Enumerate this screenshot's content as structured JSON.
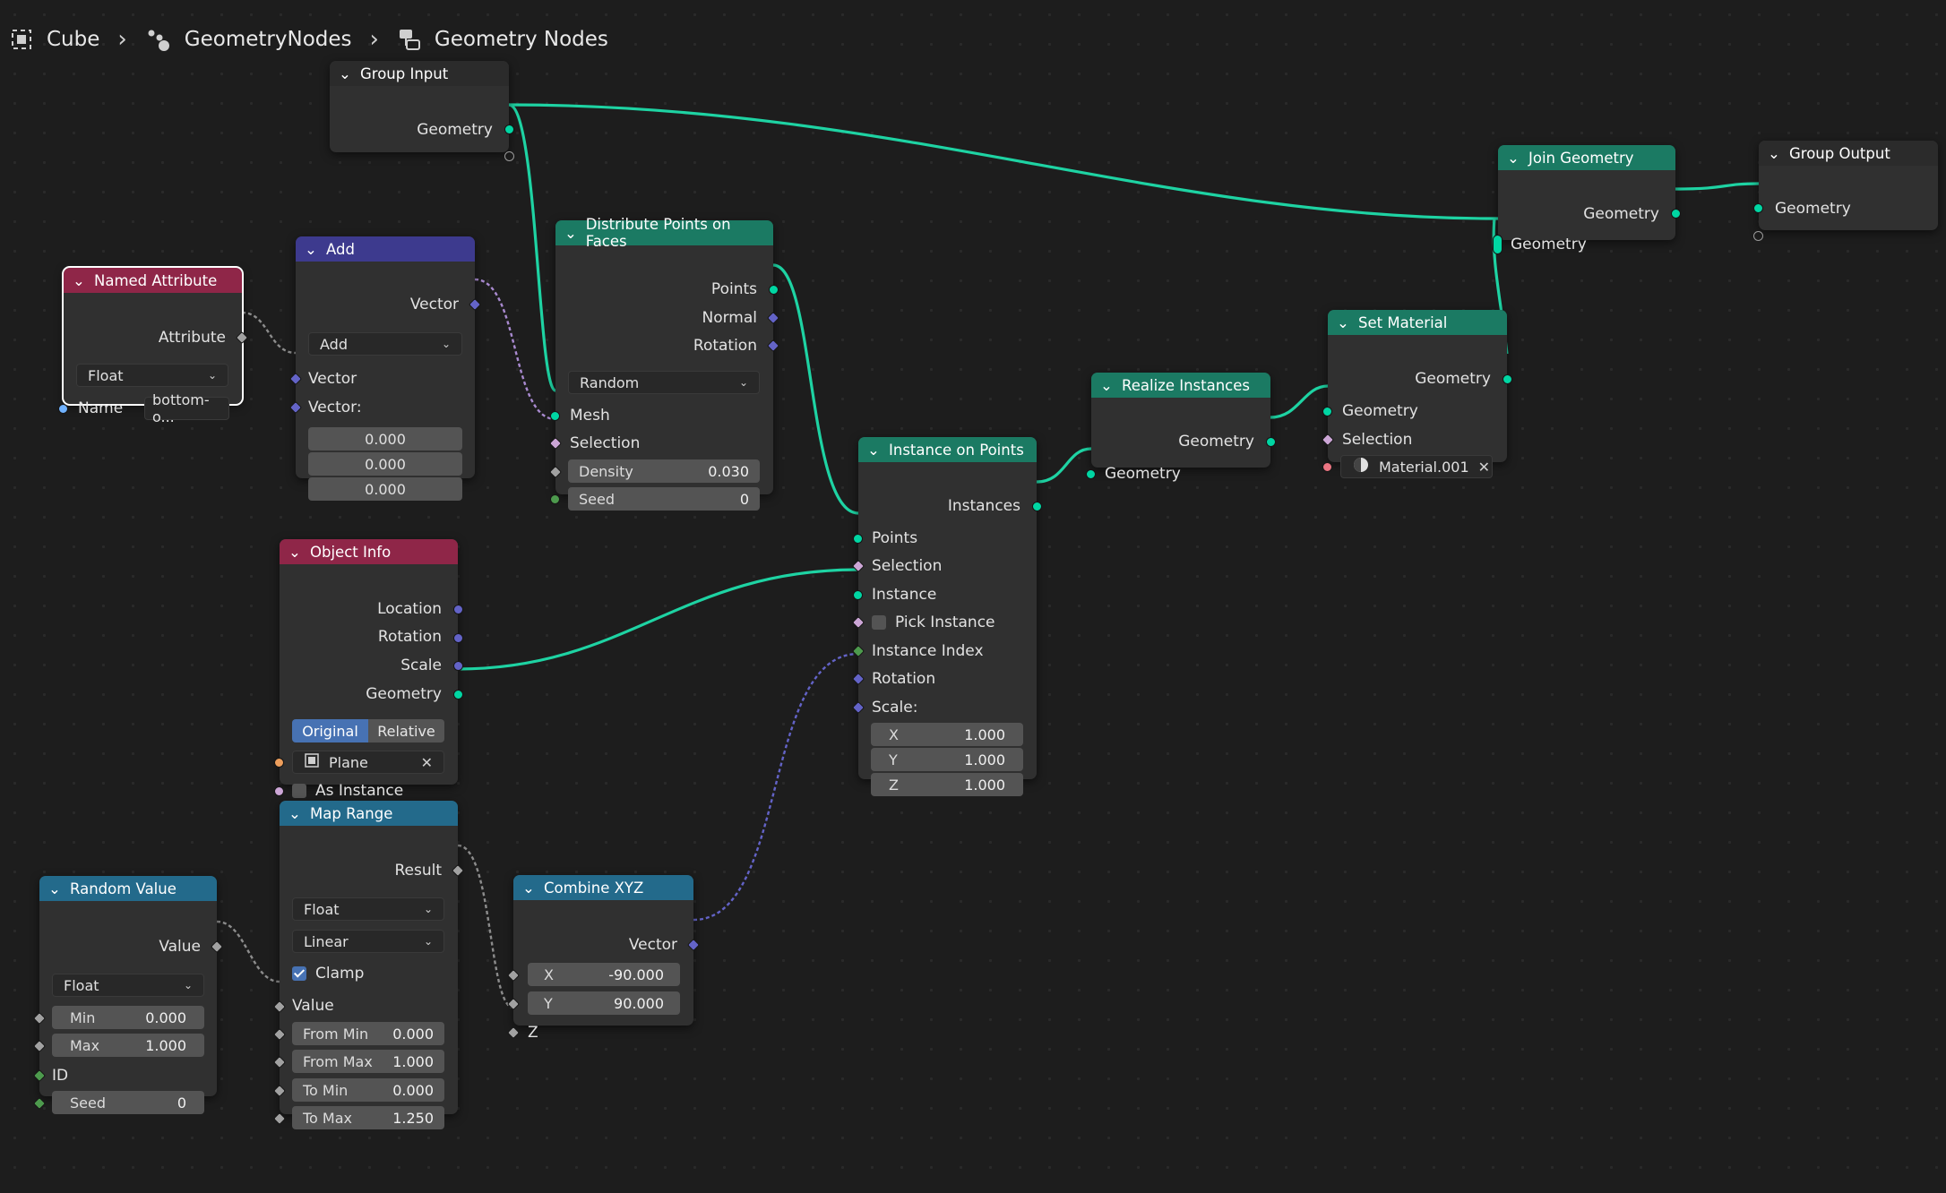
{
  "breadcrumb": {
    "object": "Cube",
    "modifier": "GeometryNodes",
    "tree": "Geometry Nodes"
  },
  "colors": {
    "geometry_socket": "#00d6a3",
    "vector_socket": "#6363c7",
    "float_socket": "#a1a1a1",
    "integer_socket": "#4d9a4d",
    "boolean_socket": "#cca6d6",
    "string_socket": "#70b2ff",
    "object_socket": "#ed9e5c",
    "material_socket": "#eb7582"
  },
  "nodes": {
    "group_input": {
      "title": "Group Input",
      "geometry": "Geometry"
    },
    "group_output": {
      "title": "Group Output",
      "geometry": "Geometry"
    },
    "join_geometry": {
      "title": "Join Geometry",
      "out_geometry": "Geometry",
      "in_geometry": "Geometry"
    },
    "named_attribute": {
      "title": "Named Attribute",
      "attribute": "Attribute",
      "type": "Float",
      "name_label": "Name",
      "name_value": "bottom-o..."
    },
    "add": {
      "title": "Add",
      "out_vector": "Vector",
      "operation": "Add",
      "in_vector1": "Vector",
      "in_vector2": "Vector:",
      "v0": "0.000",
      "v1": "0.000",
      "v2": "0.000"
    },
    "distribute": {
      "title": "Distribute Points on Faces",
      "points": "Points",
      "normal": "Normal",
      "rotation": "Rotation",
      "mode": "Random",
      "mesh": "Mesh",
      "selection": "Selection",
      "density_label": "Density",
      "density_value": "0.030",
      "seed_label": "Seed",
      "seed_value": "0"
    },
    "realize": {
      "title": "Realize Instances",
      "out_geometry": "Geometry",
      "in_geometry": "Geometry"
    },
    "set_material": {
      "title": "Set Material",
      "out_geometry": "Geometry",
      "in_geometry": "Geometry",
      "selection": "Selection",
      "material": "Material.001"
    },
    "instance_on_points": {
      "title": "Instance on Points",
      "instances": "Instances",
      "points": "Points",
      "selection": "Selection",
      "instance": "Instance",
      "pick_instance": "Pick Instance",
      "instance_index": "Instance Index",
      "rotation": "Rotation",
      "scale": "Scale:",
      "sx_label": "X",
      "sx_value": "1.000",
      "sy_label": "Y",
      "sy_value": "1.000",
      "sz_label": "Z",
      "sz_value": "1.000"
    },
    "object_info": {
      "title": "Object Info",
      "location": "Location",
      "rotation": "Rotation",
      "scale": "Scale",
      "geometry": "Geometry",
      "original": "Original",
      "relative": "Relative",
      "object": "Plane",
      "as_instance": "As Instance"
    },
    "map_range": {
      "title": "Map Range",
      "result": "Result",
      "type": "Float",
      "interpolation": "Linear",
      "clamp": "Clamp",
      "value": "Value",
      "from_min_label": "From Min",
      "from_min_value": "0.000",
      "from_max_label": "From Max",
      "from_max_value": "1.000",
      "to_min_label": "To Min",
      "to_min_value": "0.000",
      "to_max_label": "To Max",
      "to_max_value": "1.250"
    },
    "random_value": {
      "title": "Random Value",
      "value": "Value",
      "type": "Float",
      "min_label": "Min",
      "min_value": "0.000",
      "max_label": "Max",
      "max_value": "1.000",
      "id": "ID",
      "seed_label": "Seed",
      "seed_value": "0"
    },
    "combine_xyz": {
      "title": "Combine XYZ",
      "vector": "Vector",
      "x_label": "X",
      "x_value": "-90.000",
      "y_label": "Y",
      "y_value": "90.000",
      "z": "Z"
    }
  }
}
